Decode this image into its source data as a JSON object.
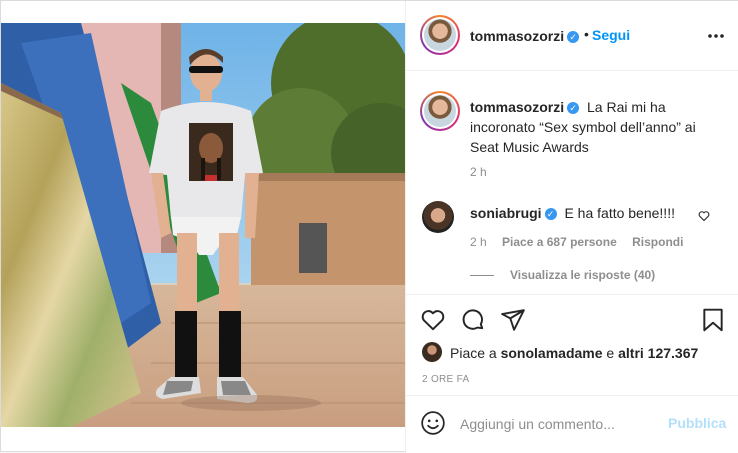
{
  "post": {
    "author": {
      "username": "tommasozorzi",
      "verified_icon": "verified-badge-icon",
      "follow_label": "Segui",
      "separator": "•"
    },
    "caption": {
      "username": "tommasozorzi",
      "text": "La Rai mi ha incoronato “Sex symbol dell’anno” ai Seat Music Awards",
      "time": "2 h"
    },
    "comments": [
      {
        "username": "soniabrugi",
        "text": "E ha fatto bene!!!!",
        "time": "2 h",
        "likes": "Piace a 687 persone",
        "reply_label": "Rispondi",
        "view_replies": "Visualizza le risposte (40)"
      }
    ],
    "likes": {
      "prefix": "Piace a ",
      "user": "sonolamadame",
      "middle": " e ",
      "others": "altri 127.367"
    },
    "post_time": "2 ORE FA",
    "add_comment": {
      "placeholder": "Aggiungi un commento...",
      "publish_label": "Pubblica"
    },
    "icons": {
      "like": "heart-icon",
      "comment": "comment-icon",
      "share": "share-icon",
      "save": "bookmark-icon",
      "more": "more-options-icon",
      "emoji": "emoji-icon"
    },
    "colors": {
      "link_blue": "#0095f6",
      "publish_disabled": "#b2dffc",
      "secondary_text": "#8e8e8e",
      "verified_blue": "#3897f0"
    }
  }
}
